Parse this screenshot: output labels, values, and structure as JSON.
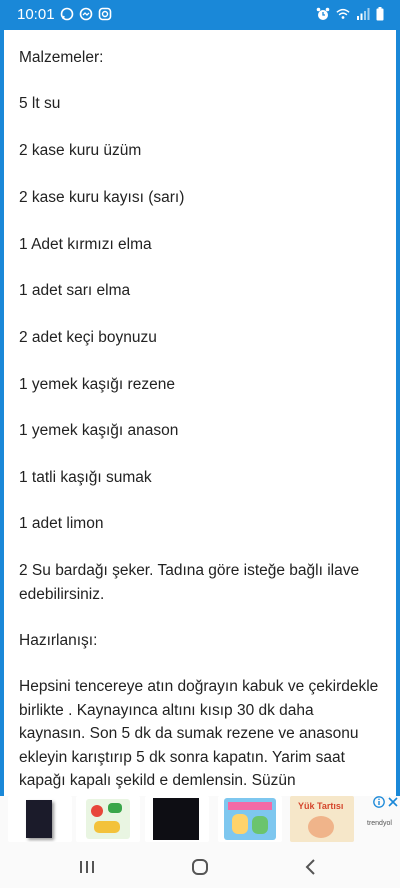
{
  "status": {
    "time": "10:01",
    "left_icons": [
      "whatsapp-icon",
      "messenger-icon",
      "instagram-icon"
    ],
    "right_icons": [
      "alarm-icon",
      "wifi-icon",
      "signal-icon",
      "battery-icon"
    ]
  },
  "article": {
    "ingredients_heading": "Malzemeler:",
    "ingredients": [
      "5 lt su",
      "2  kase kuru üzüm",
      "2  kase kuru kayısı (sarı)",
      "1 Adet kırmızı elma",
      "1 adet sarı elma",
      "2 adet keçi boynuzu",
      "1 yemek kaşığı rezene",
      "1 yemek kaşığı anason",
      "1 tatli kaşığı sumak",
      "1 adet limon",
      "2 Su bardağı şeker.  Tadına göre isteğe bağlı ilave edebilirsiniz."
    ],
    "preparation_heading": "Hazırlanışı:",
    "preparation_text": "Hepsini tencereye atın doğrayın kabuk ve çekirdekle birlikte . Kaynayınca altını kısıp 30 dk daha kaynasın. Son 5 dk da sumak rezene ve anasonu ekleyin karıştırıp 5 dk sonra kapatın. Yarim saat kapağı kapalı şekild e demlensin.  Süzün"
  },
  "ad": {
    "thumbs": [
      "book-cover-dark",
      "kids-book-green",
      "book-cover-black",
      "kids-book-colorful",
      "book-cover-yuk-tartisi"
    ],
    "book_title": "Yük Tartısı",
    "brand": "trendyol",
    "info_icon": "info-icon",
    "close_icon": "close-icon",
    "accent": "#1a88d8"
  },
  "nav": {
    "recents_icon": "recents-icon",
    "home_icon": "home-icon",
    "back_icon": "back-icon"
  }
}
